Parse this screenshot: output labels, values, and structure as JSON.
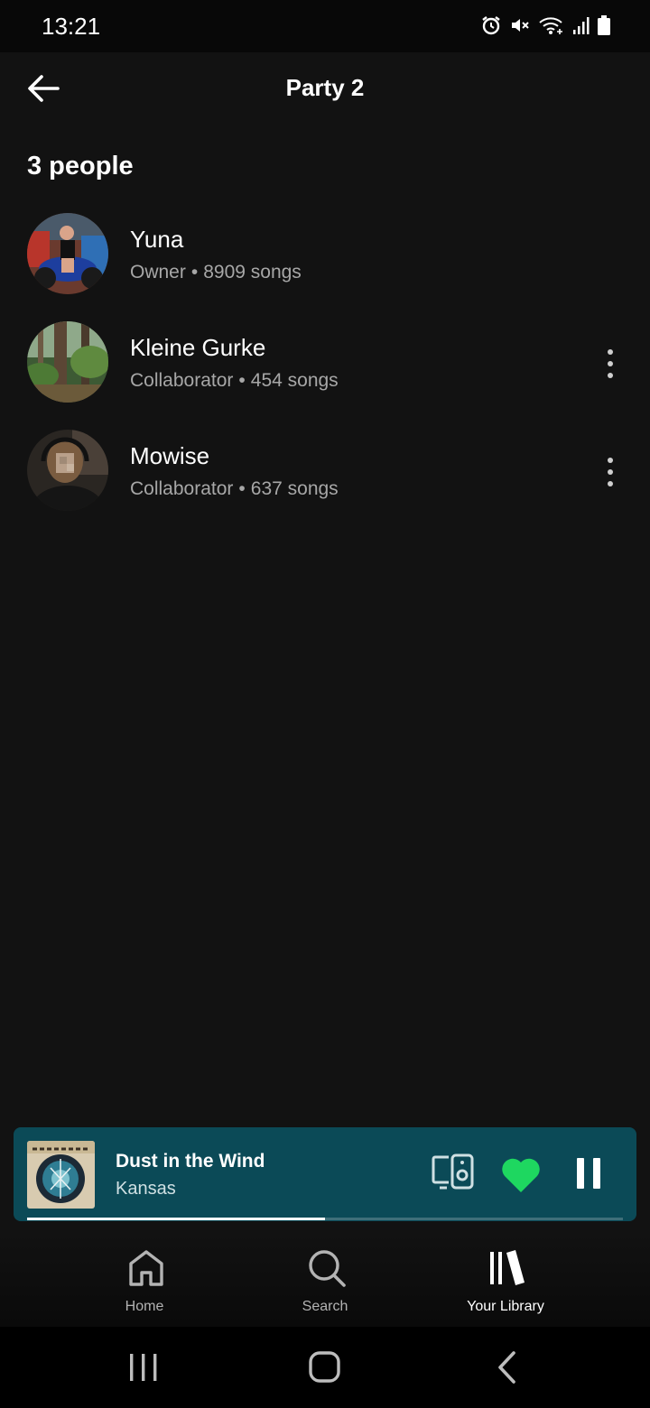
{
  "status_bar": {
    "time": "13:21",
    "icons": [
      "alarm-icon",
      "mute-icon",
      "wifi-icon",
      "signal-icon",
      "battery-icon"
    ]
  },
  "header": {
    "title": "Party 2",
    "back_icon": "arrow-left-icon"
  },
  "section": {
    "title": "3 people"
  },
  "members": [
    {
      "name": "Yuna",
      "role": "Owner",
      "separator": "•",
      "songs": "8909 songs",
      "has_menu": false
    },
    {
      "name": "Kleine Gurke",
      "role": "Collaborator",
      "separator": "•",
      "songs": "454 songs",
      "has_menu": true
    },
    {
      "name": "Mowise",
      "role": "Collaborator",
      "separator": "•",
      "songs": "637 songs",
      "has_menu": true
    }
  ],
  "now_playing": {
    "title": "Dust in the Wind",
    "artist": "Kansas",
    "liked": true,
    "playing": true,
    "progress": 0.5,
    "background_color": "#0b4a57",
    "heart_color": "#1ed760"
  },
  "bottom_nav": {
    "items": [
      {
        "label": "Home",
        "icon": "home-icon",
        "active": false
      },
      {
        "label": "Search",
        "icon": "search-icon",
        "active": false
      },
      {
        "label": "Your Library",
        "icon": "library-icon",
        "active": true
      }
    ]
  },
  "system_nav": {
    "items": [
      "recents-icon",
      "home-circle-icon",
      "back-chevron-icon"
    ]
  }
}
